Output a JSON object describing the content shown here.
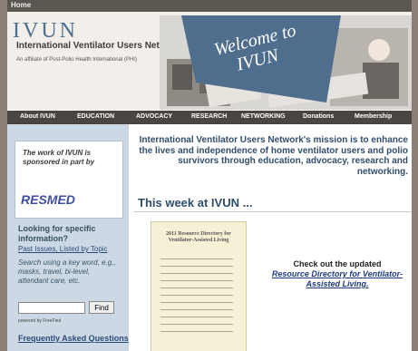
{
  "topbar": {
    "label": "Home"
  },
  "header": {
    "logo": "IVUN",
    "org_name": "International Ventilator Users Network",
    "affiliation": "An affiliate of Post-Polio Health International (PHI)",
    "welcome": "Welcome to IVUN",
    "welcome_line1": "Welcome to",
    "welcome_line2": "IVUN"
  },
  "nav": {
    "items": [
      {
        "label": "About IVUN"
      },
      {
        "label": "EDUCATION"
      },
      {
        "label": "ADVOCACY"
      },
      {
        "label": "RESEARCH"
      },
      {
        "label": "NETWORKING"
      },
      {
        "label": "Donations"
      },
      {
        "label": "Membership"
      }
    ]
  },
  "sidebar": {
    "sponsor_text": "The work of IVUN is sponsored in part by",
    "sponsor_logo": "RESMED",
    "looking": "Looking for specific information?",
    "past_issues": "Past Issues, Listed by Topic",
    "search_hint": "Search using a key word, e.g., masks, travel, bi-level, attendant care, etc.",
    "search_value": "",
    "find_label": "Find",
    "powered_by": "powered by FreeFind",
    "faq": "Frequently Asked Questions"
  },
  "main": {
    "mission": "International Ventilator Users Network's mission is to enhance the lives and independence of home ventilator users and polio survivors through education, advocacy, research and networking.",
    "week_title": "This week at IVUN ...",
    "doc_title": "2011 Resource Directory for Ventilator-Assisted Living",
    "checkout_prefix": "Check out the updated",
    "checkout_link": "Resource Directory for Ventilator-Assisted Living."
  },
  "colors": {
    "nav_bg": "#4a4541",
    "sidebar_bg": "#ccd9e5",
    "banner_blue": "#4f6e8d",
    "heading_blue": "#324d6b"
  }
}
